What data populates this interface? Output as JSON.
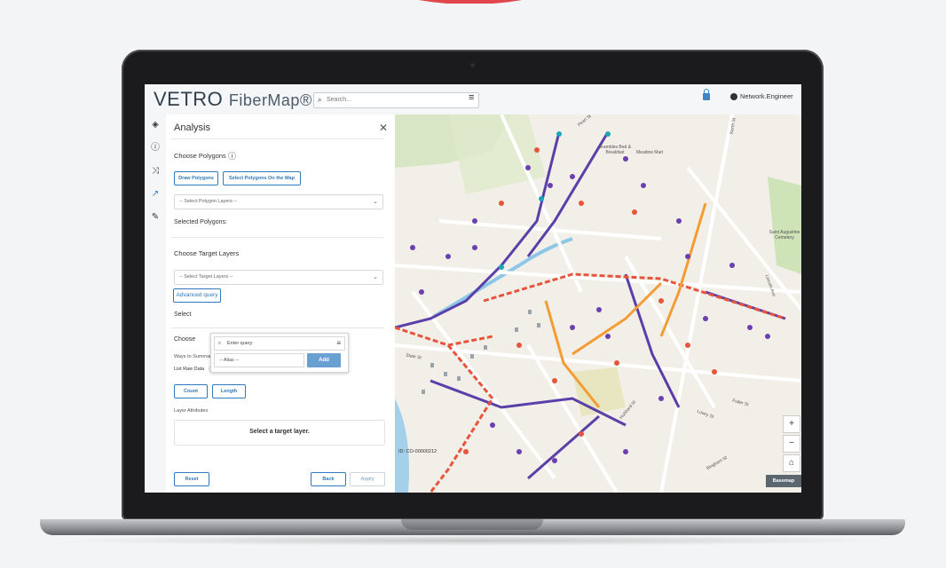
{
  "app": {
    "logo_main": "VETRO",
    "logo_sub": "FiberMap®",
    "search_placeholder": "Search...",
    "user_name": "Network.Engineer"
  },
  "panel": {
    "title": "Analysis",
    "choose_polygons": "Choose Polygons",
    "draw_polygons": "Draw Polygons",
    "select_polygons_on_map": "Select Polygons On the Map",
    "select_polygon_layers": "-- Select Polygon Layers --",
    "selected_polygons": "Selected Polygons:",
    "choose_target_layers": "Choose Target Layers",
    "select_target_layers": "-- Select Target Layers --",
    "advanced_query": "Advanced query",
    "select_partial": "Select",
    "choose_partial": "Choose",
    "ways_to_summarize": "Ways to Summarize Attributes",
    "list_raw_data": "List Raw Data",
    "count": "Count",
    "length": "Length",
    "layer_attributes": "Layer Attributes",
    "select_target_layer_msg": "Select a target layer.",
    "reset": "Reset",
    "back": "Back",
    "apply": "Apply"
  },
  "query_popup": {
    "placeholder": "Enter query",
    "alias_placeholder": "-- Alias --",
    "add": "Add"
  },
  "map": {
    "id_label": "ID: CO-00000212",
    "basemap": "Basemap",
    "zoom_in": "+",
    "zoom_out": "−",
    "home": "⌂",
    "labels": [
      "Pearl St",
      "North St",
      "Brambles Bed & Breakfast",
      "Meadow Mart",
      "Saint Augustine Cemetery",
      "State St",
      "Fuller St",
      "Bingham St",
      "Lincoln Ave",
      "Hubbard St",
      "Lowry St"
    ]
  }
}
